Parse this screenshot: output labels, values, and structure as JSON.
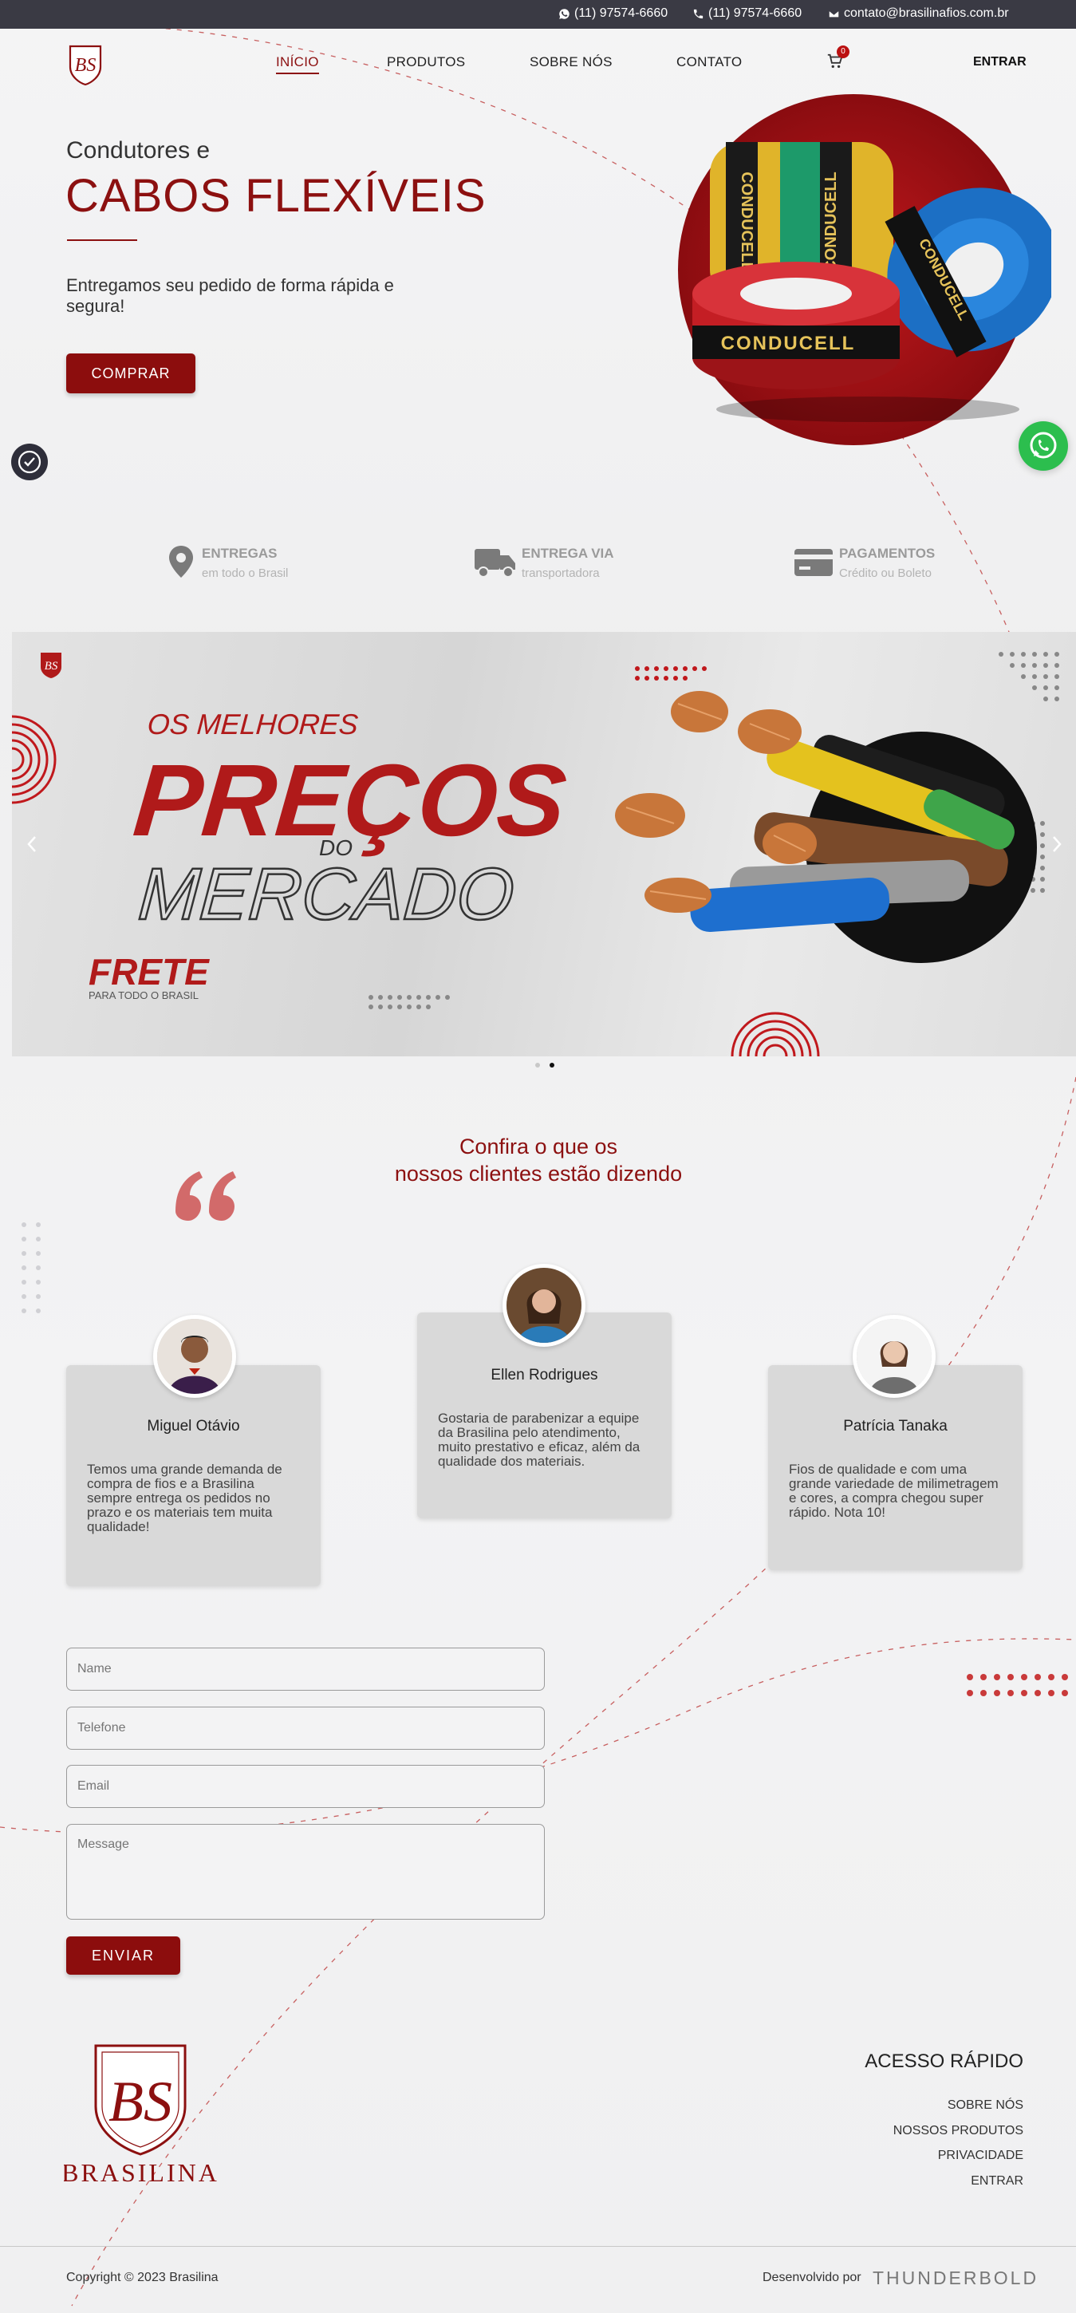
{
  "topbar": {
    "phone1": "(11) 97574-6660",
    "phone2": "(11) 97574-6660",
    "email": "contato@brasilinafios.com.br"
  },
  "nav": {
    "items": [
      "INÍCIO",
      "PRODUTOS",
      "SOBRE NÓS",
      "CONTATO"
    ],
    "cart_count": "0",
    "login": "ENTRAR"
  },
  "hero": {
    "pretitle": "Condutores e",
    "title": "CABOS FLEXÍVEIS",
    "subtitle": "Entregamos seu pedido de forma rápida e segura!",
    "cta": "COMPRAR",
    "product_brand": "CONDUCELL"
  },
  "features": [
    {
      "title": "ENTREGAS",
      "subtitle": "em todo o Brasil",
      "icon": "map-pin-icon"
    },
    {
      "title": "ENTREGA VIA",
      "subtitle": "transportadora",
      "icon": "truck-icon"
    },
    {
      "title": "PAGAMENTOS",
      "subtitle": "Crédito ou Boleto",
      "icon": "credit-card-icon"
    }
  ],
  "banner": {
    "line1": "OS MELHORES",
    "line2": "PREÇOS",
    "line3": "DO",
    "line4": "MERCADO",
    "frete": "FRETE",
    "frete_sub": "PARA TODO O BRASIL",
    "logo": "BS",
    "active_slide": 2,
    "slide_count": 2
  },
  "testimonials": {
    "title_line1": "Confira o que os",
    "title_line2": "nossos clientes estão dizendo",
    "items": [
      {
        "name": "Miguel Otávio",
        "text": "Temos uma grande demanda de compra de fios e a Brasilina sempre entrega os pedidos no prazo e os materiais tem muita qualidade!"
      },
      {
        "name": "Ellen Rodrigues",
        "text": "Gostaria de parabenizar a equipe da Brasilina pelo atendimento, muito prestativo e eficaz, além da qualidade dos materiais."
      },
      {
        "name": "Patrícia Tanaka",
        "text": "Fios de qualidade e com uma grande variedade de milimetragem e cores, a compra chegou super rápido. Nota 10!"
      }
    ]
  },
  "form": {
    "name_placeholder": "Name",
    "phone_placeholder": "Telefone",
    "email_placeholder": "Email",
    "message_placeholder": "Message",
    "submit": "ENVIAR"
  },
  "footer": {
    "logo_mark": "BS",
    "logo_text": "BRASILINA",
    "quick_title": "ACESSO RÁPIDO",
    "links": [
      "SOBRE NÓS",
      "NOSSOS PRODUTOS",
      "PRIVACIDADE",
      "ENTRAR"
    ],
    "copyright": "Copyright © 2023 Brasilina",
    "developed_by": "Desenvolvido por",
    "developer": "THUNDERBOLD"
  },
  "colors": {
    "brand": "#8c1010",
    "topbar": "#3a3a44",
    "whatsapp": "#2cbe4e"
  }
}
